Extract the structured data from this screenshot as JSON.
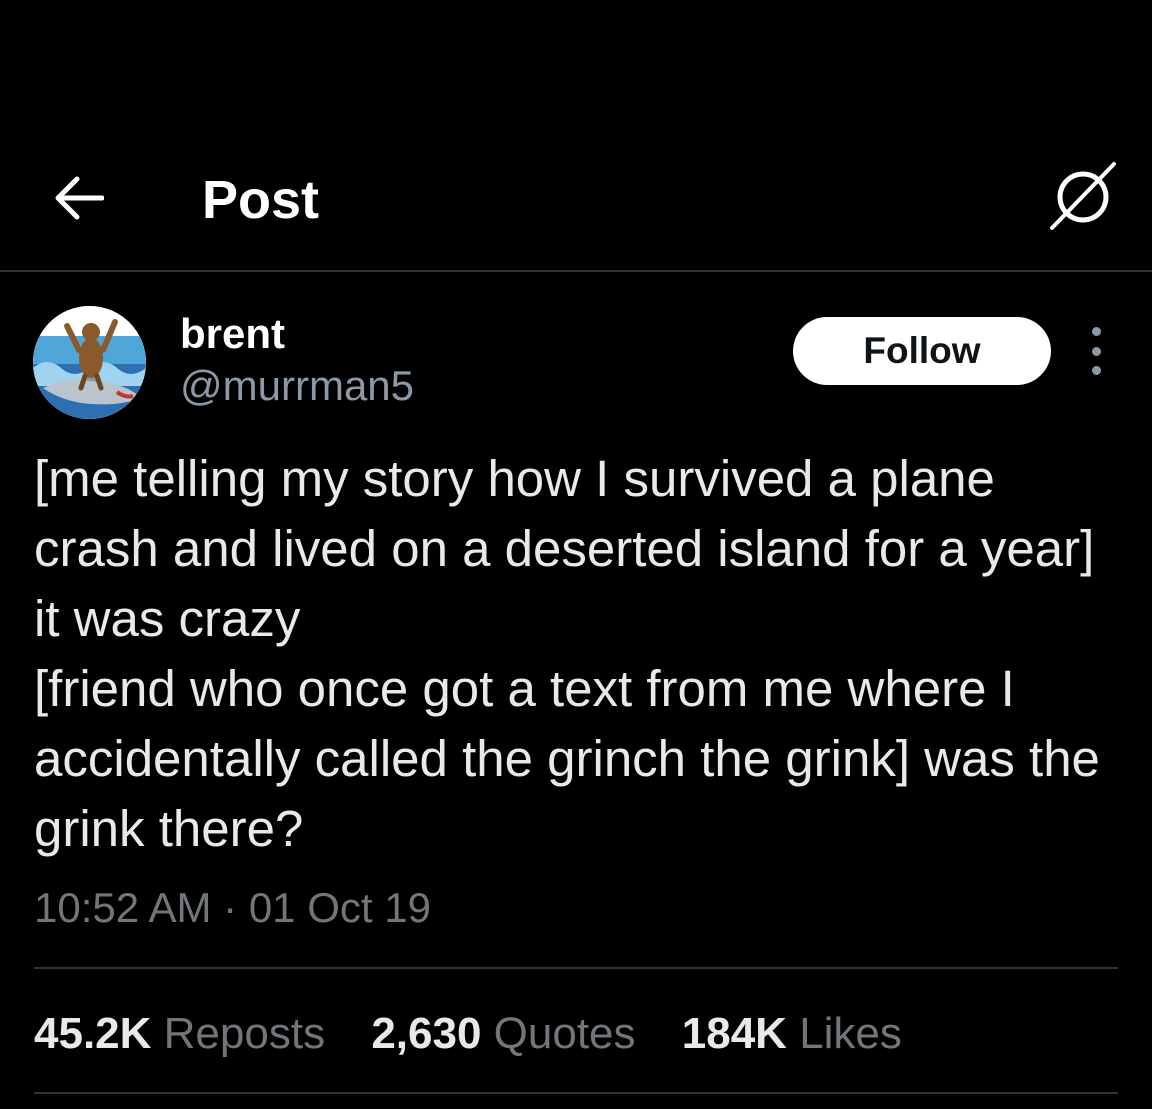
{
  "header": {
    "title": "Post",
    "back_icon": "arrow-left-icon",
    "grok_icon": "grok-icon"
  },
  "author": {
    "display_name": "brent",
    "handle": "@murrman5",
    "avatar_icon": "avatar-bear-riding-shark",
    "follow_label": "Follow",
    "more_icon": "more-vertical-icon"
  },
  "tweet": {
    "text": "[me telling my story how I survived a plane crash and lived on a deserted island for a year] it was crazy\n[friend who once got a text from me where I accidentally called the grinch the grink] was the grink there?",
    "time": "10:52 AM",
    "separator": "·",
    "date": "01 Oct 19"
  },
  "stats": {
    "reposts_count": "45.2K",
    "reposts_label": "Reposts",
    "quotes_count": "2,630",
    "quotes_label": "Quotes",
    "likes_count": "184K",
    "likes_label": "Likes"
  },
  "colors": {
    "background": "#000000",
    "primary_text": "#e7e9ea",
    "secondary_text": "#71767b",
    "handle_text": "#8b98a5",
    "divider": "#2f3336",
    "follow_button_bg": "#ffffff",
    "follow_button_text": "#0f1419"
  }
}
